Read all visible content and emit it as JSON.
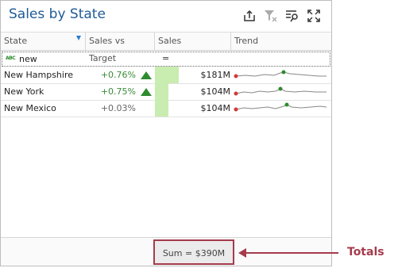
{
  "title": "Sales by State",
  "toolbar": {
    "icons": [
      "export-icon",
      "clear-filter-icon",
      "multiselect-filter-icon",
      "maximize-icon"
    ]
  },
  "grid": {
    "columns": [
      {
        "label": "State"
      },
      {
        "label": "Sales vs Target"
      },
      {
        "label": "Sales"
      },
      {
        "label": "Trend"
      }
    ],
    "filter_text": "new",
    "filter_abc": "ABC",
    "filter_operator": "=",
    "rows": [
      {
        "state": "New Hampshire",
        "delta": "+0.76%",
        "trend": "up",
        "sales": "$181M",
        "bar_fraction": 1.0
      },
      {
        "state": "New York",
        "delta": "+0.75%",
        "trend": "up",
        "sales": "$104M",
        "bar_fraction": 0.57
      },
      {
        "state": "New Mexico",
        "delta": "+0.03%",
        "trend": "none",
        "sales": "$104M",
        "bar_fraction": 0.57
      }
    ]
  },
  "totals": {
    "text": "Sum = $390M"
  },
  "callout": {
    "label": "Totals"
  },
  "colors": {
    "accent": "#1f5a96",
    "positive": "#3a8a3a",
    "bar": "#c9ecb0",
    "callout": "#a53b4d"
  }
}
